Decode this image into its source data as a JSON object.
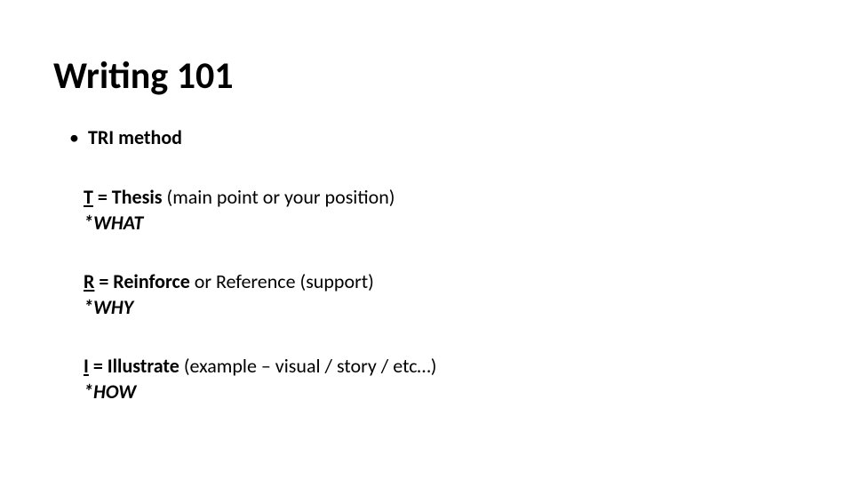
{
  "title": "Writing 101",
  "bullet": {
    "marker": "•",
    "label": "TRI method"
  },
  "items": [
    {
      "letter": "T",
      "label": " = Thesis",
      "desc": " (main point or your position)",
      "tag": "*WHAT"
    },
    {
      "letter": "R",
      "label": " = Reinforce",
      "desc": " or Reference (support)",
      "tag": "*WHY"
    },
    {
      "letter": "I",
      "label": " = Illustrate",
      "desc": " (example – visual / story / etc…)",
      "tag": "*HOW"
    }
  ]
}
